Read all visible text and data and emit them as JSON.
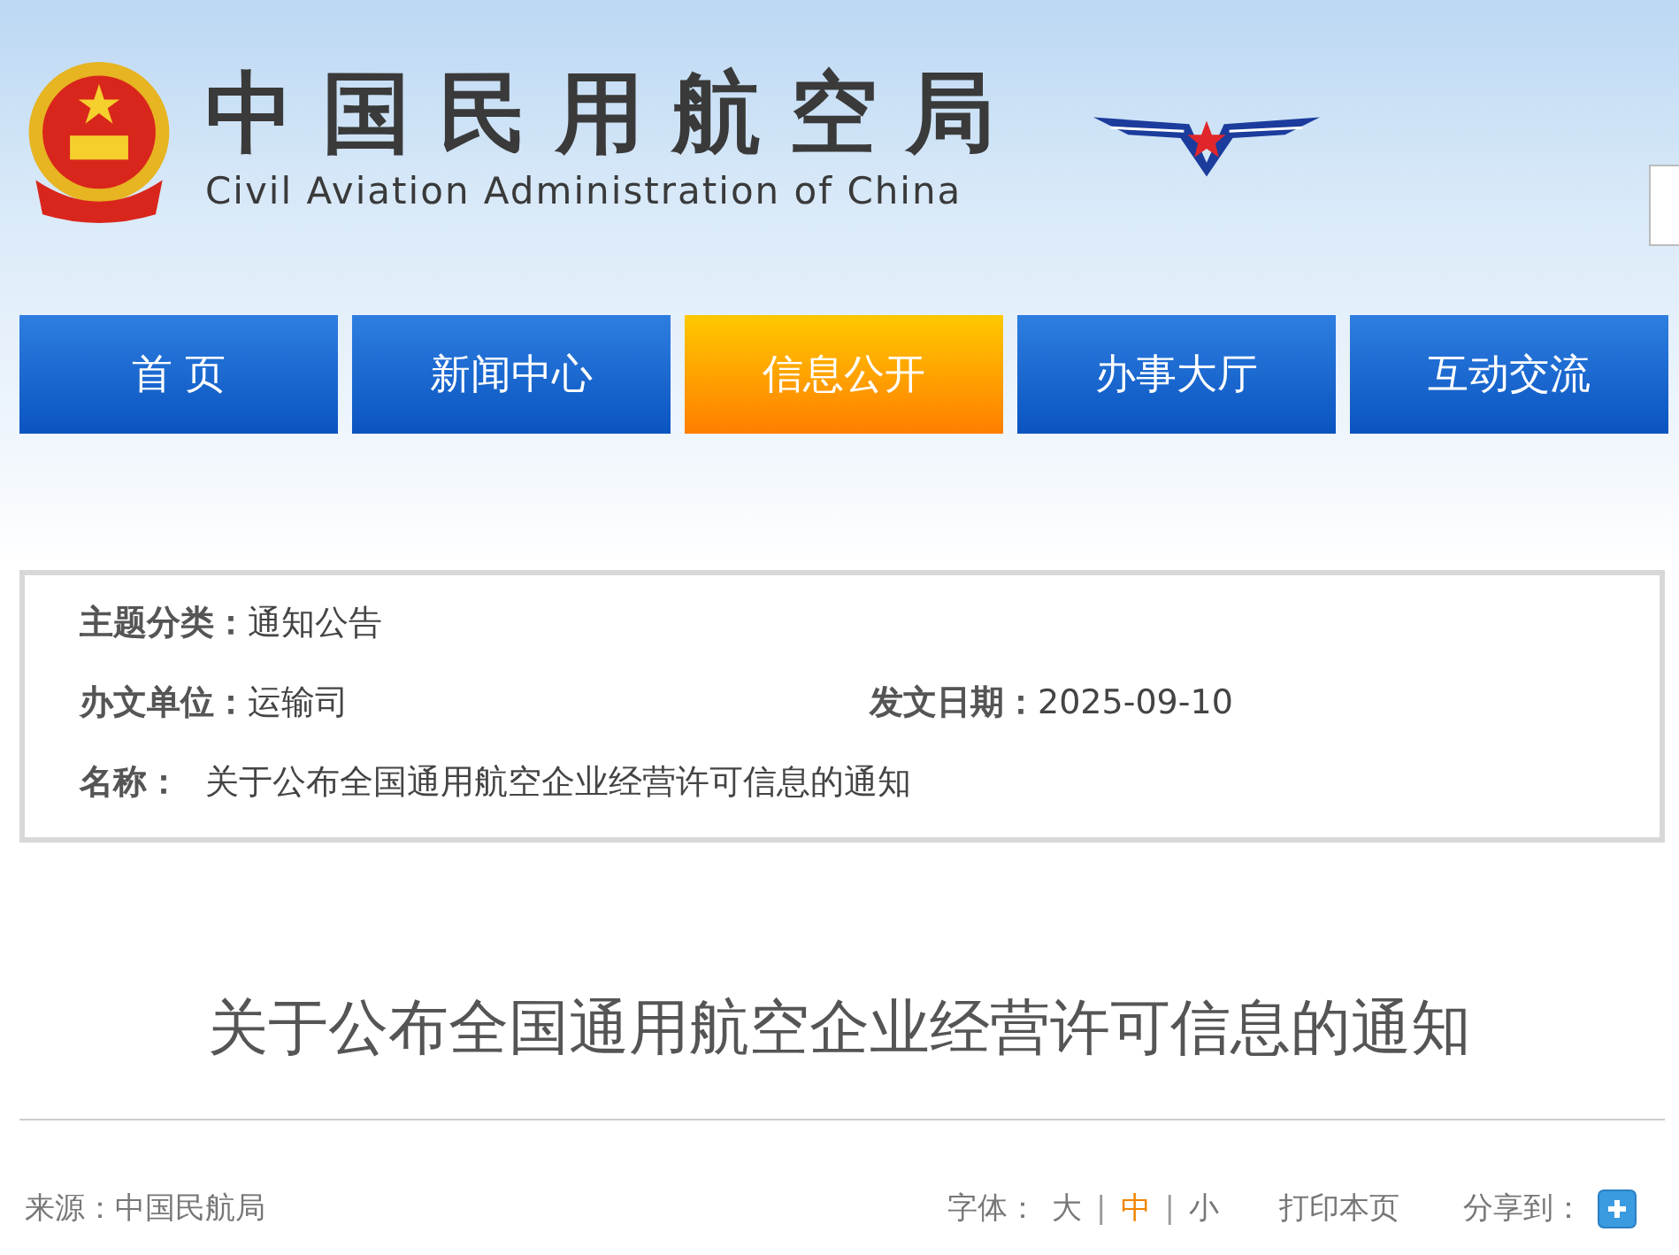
{
  "header": {
    "title": "中国民用航空局",
    "subtitle": "Civil Aviation Administration of China"
  },
  "nav": [
    {
      "label": "首 页",
      "selected": false
    },
    {
      "label": "新闻中心",
      "selected": false
    },
    {
      "label": "信息公开",
      "selected": true
    },
    {
      "label": "办事大厅",
      "selected": false
    },
    {
      "label": "互动交流",
      "selected": false
    }
  ],
  "info": {
    "topic_label": "主题分类：",
    "topic": "通知公告",
    "unit_label": "办文单位：",
    "unit": "运输司",
    "date_label": "发文日期：",
    "date": "2025-09-10",
    "name_label": "名称：",
    "name": "关于公布全国通用航空企业经营许可信息的通知"
  },
  "article": {
    "title": "关于公布全国通用航空企业经营许可信息的通知",
    "source": "来源：中国民航局"
  },
  "tools": {
    "font_label": "字体：",
    "font_sizes": [
      {
        "label": "大",
        "selected": false
      },
      {
        "label": "中",
        "selected": true
      },
      {
        "label": "小",
        "selected": false
      }
    ],
    "separator": "|",
    "print": "打印本页",
    "share": "分享到："
  }
}
